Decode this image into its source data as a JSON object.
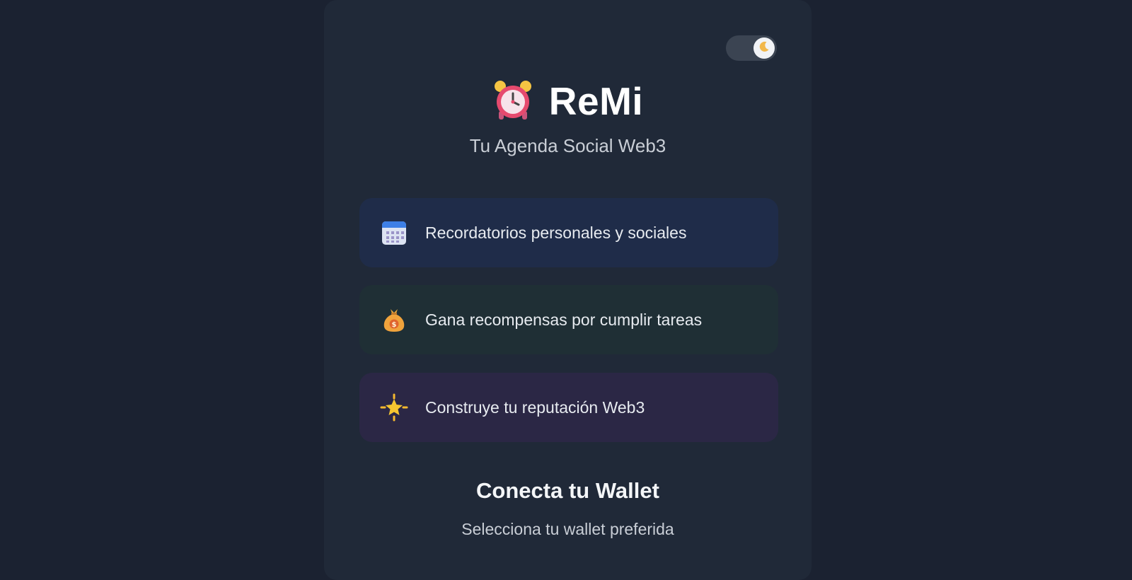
{
  "theme_toggle": {
    "icon": "moon-icon",
    "state": "dark"
  },
  "brand": {
    "icon": "alarm-clock-icon",
    "title": "ReMi",
    "tagline": "Tu Agenda Social Web3"
  },
  "features": [
    {
      "icon": "calendar-icon",
      "label": "Recordatorios personales y sociales",
      "color": "#1f2c49"
    },
    {
      "icon": "money-bag-icon",
      "label": "Gana recompensas por cumplir tareas",
      "color": "#1f2f35"
    },
    {
      "icon": "glowing-star-icon",
      "label": "Construye tu reputación Web3",
      "color": "#2b2745"
    }
  ],
  "wallet": {
    "title": "Conecta tu Wallet",
    "subtitle": "Selecciona tu wallet preferida"
  }
}
